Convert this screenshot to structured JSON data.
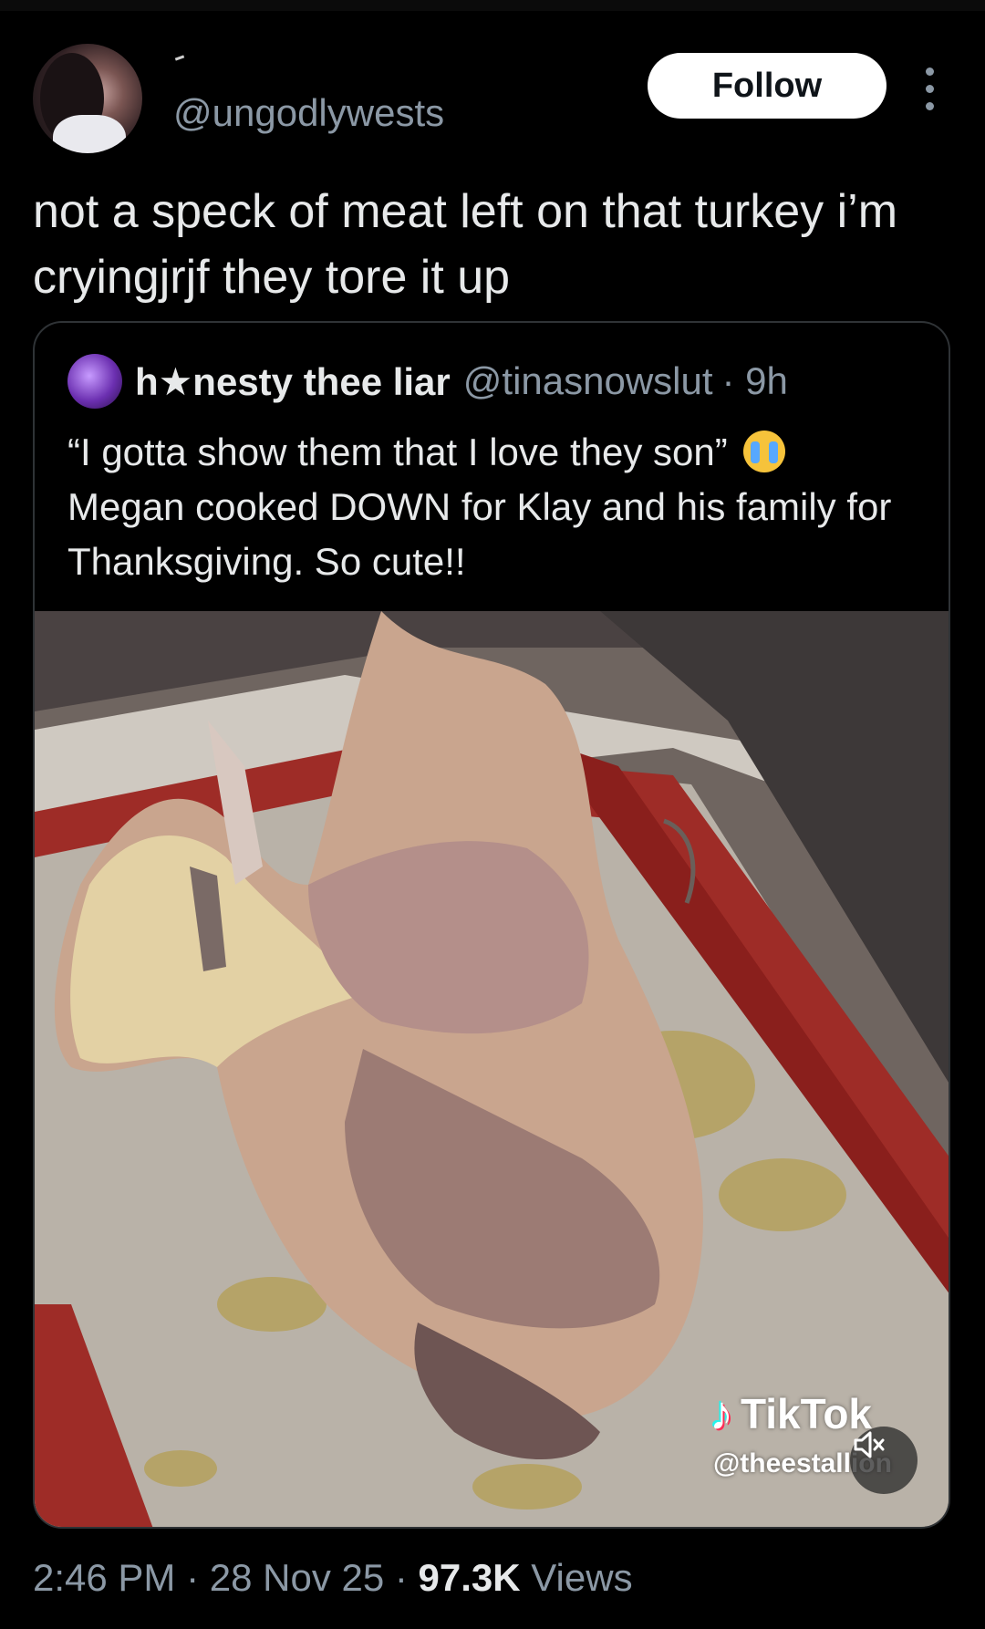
{
  "tweet": {
    "handle": "@ungodlywests",
    "follow_label": "Follow",
    "text": "not a speck of meat left on that turkey i’m cryingjrjf they tore it up"
  },
  "quote": {
    "display_name": "h★nesty thee liar",
    "handle": "@tinasnowslut",
    "time": "· 9h",
    "text": "“I gotta show them that I love they son”",
    "text_2": "Megan cooked DOWN for Klay and his family for Thanksgiving. So cute!!",
    "emoji": "loudly-crying-face",
    "media": {
      "watermark_brand": "TikTok",
      "watermark_user": "@theestallion",
      "muted": true
    }
  },
  "meta": {
    "time": "2:46 PM",
    "date": "28 Nov 25",
    "views_count": "97.3K",
    "views_label": "Views"
  },
  "colors": {
    "background": "#000000",
    "text": "#e7e9ea",
    "secondary_text": "#8b98a5",
    "follow_button_bg": "#ffffff",
    "border": "#2f3336"
  }
}
